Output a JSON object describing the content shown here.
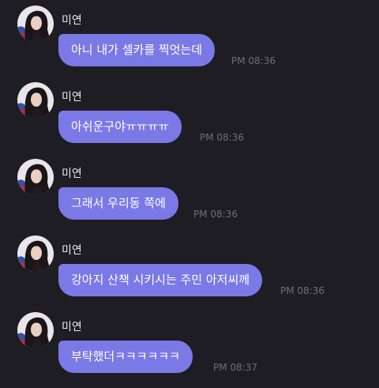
{
  "theme": {
    "background": "#1d1d23",
    "bubble_color": "#7b79e6",
    "text_color": "#ffffff",
    "time_color": "#6f6f78"
  },
  "messages": [
    {
      "sender": "미연",
      "avatar_icon": "profile-photo",
      "text": "아니 내가 셀카를 찍엇는데",
      "time": "PM 08:36"
    },
    {
      "sender": "미연",
      "avatar_icon": "profile-photo",
      "text": "아쉬운구야ㅠㅠㅠㅠ",
      "time": "PM 08:36"
    },
    {
      "sender": "미연",
      "avatar_icon": "profile-photo",
      "text": "그래서 우리동 쪽에",
      "time": "PM 08:36"
    },
    {
      "sender": "미연",
      "avatar_icon": "profile-photo",
      "text": "강아지 산책 시키시는 주민 아저씨께",
      "time": "PM 08:36"
    },
    {
      "sender": "미연",
      "avatar_icon": "profile-photo",
      "text": "부탁했더ㅋㅋㅋㅋㅋㅋ",
      "time": "PM 08:37"
    }
  ]
}
